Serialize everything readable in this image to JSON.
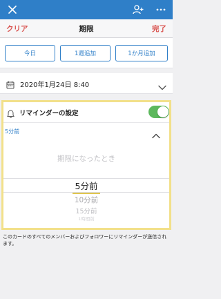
{
  "topbar": {
    "close_icon": "close-icon",
    "add_member_icon": "add-person-icon",
    "more_icon": "more-icon"
  },
  "header": {
    "clear_label": "クリア",
    "title": "期限",
    "done_label": "完了"
  },
  "quick_add": {
    "today": "今日",
    "add_week": "1週追加",
    "add_month": "1か月追加"
  },
  "due_date": {
    "value": "2020年1月24日 8:40"
  },
  "reminder": {
    "title": "リマインダーの設定",
    "enabled": true,
    "selected_value": "5分前",
    "picker_options": [
      "期限になったとき",
      "5分前",
      "10分前",
      "15分前",
      "1時間前"
    ],
    "selected_index": 1
  },
  "note": "このカードのすべてのメンバーおよびフォロワーにリマインダーが送信されます。",
  "colors": {
    "accent": "#2f7fc8",
    "action_red": "#d9534f",
    "toggle_on": "#5cb85c",
    "highlight": "#f2e08a"
  }
}
